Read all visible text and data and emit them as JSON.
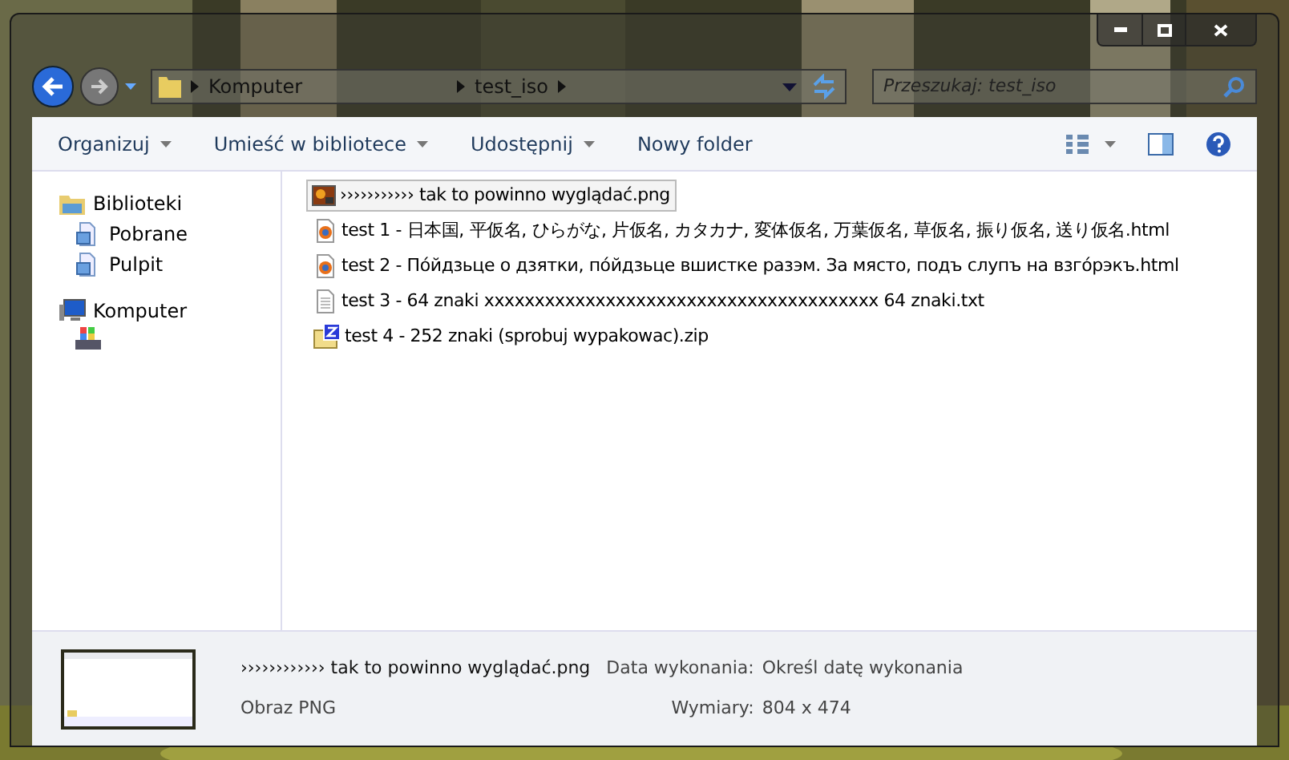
{
  "address_bar": {
    "segments": [
      "Komputer",
      "test_iso"
    ]
  },
  "search": {
    "placeholder": "Przeszukaj: test_iso"
  },
  "toolbar": {
    "items": [
      {
        "label": "Organizuj",
        "dropdown": true
      },
      {
        "label": "Umieść w bibliotece",
        "dropdown": true
      },
      {
        "label": "Udostępnij",
        "dropdown": true
      },
      {
        "label": "Nowy folder",
        "dropdown": false
      }
    ]
  },
  "sidebar": {
    "items": [
      {
        "label": "Biblioteki",
        "kind": "library",
        "children": [
          {
            "label": "Pobrane",
            "kind": "doc"
          },
          {
            "label": "Pulpit",
            "kind": "doc"
          }
        ]
      },
      {
        "label": "Komputer",
        "kind": "computer"
      }
    ]
  },
  "files": [
    {
      "name": "››››››››››› tak to powinno wyglądać.png",
      "kind": "png",
      "selected": true
    },
    {
      "name": "test 1 - 日本国, 平仮名, ひらがな, 片仮名, カタカナ, 変体仮名, 万葉仮名, 草仮名, 振り仮名, 送り仮名.html",
      "kind": "html",
      "selected": false
    },
    {
      "name": "test 2 - Пóйдзьце о дзятки, пóйдзьце вшистке разэм. За място, подъ слупъ на взгóрэкъ.html",
      "kind": "html",
      "selected": false
    },
    {
      "name": "test 3 - 64 znaki xxxxxxxxxxxxxxxxxxxxxxxxxxxxxxxxxxxxxxx 64 znaki.txt",
      "kind": "txt",
      "selected": false
    },
    {
      "name": "test 4 - 252 znaki (sprobuj wypakowac).zip",
      "kind": "zip",
      "selected": false
    }
  ],
  "details": {
    "name": "›››››››››››› tak to powinno wyglądać.png",
    "type": "Obraz PNG",
    "fields": [
      {
        "label": "Data wykonania:",
        "value": "Określ datę wykonania"
      },
      {
        "label": "Wymiary:",
        "value": "804 x 474"
      }
    ]
  }
}
